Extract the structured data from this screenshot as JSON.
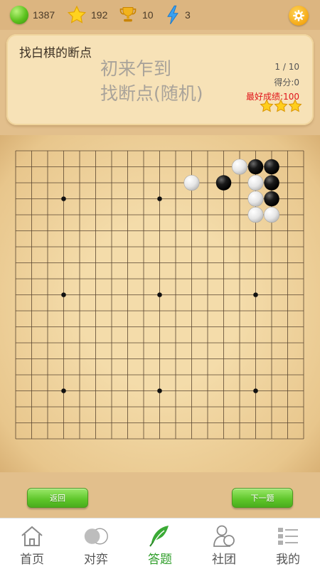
{
  "stats": {
    "gems": "1387",
    "stars": "192",
    "trophies": "10",
    "energy": "3"
  },
  "card": {
    "title": "找白棋的断点",
    "subtitle_line1": "初来乍到",
    "subtitle_line2": "找断点(随机)",
    "progress": "1 / 10",
    "score": "得分:0",
    "best": "最好成绩:100",
    "stars_earned": 3
  },
  "board": {
    "size": 19,
    "hoshi": [
      [
        3,
        3
      ],
      [
        3,
        9
      ],
      [
        3,
        15
      ],
      [
        9,
        3
      ],
      [
        9,
        9
      ],
      [
        9,
        15
      ],
      [
        15,
        3
      ],
      [
        15,
        9
      ],
      [
        15,
        15
      ]
    ],
    "stones": [
      {
        "color": "white",
        "row": 1,
        "col": 14
      },
      {
        "color": "black",
        "row": 1,
        "col": 15
      },
      {
        "color": "black",
        "row": 1,
        "col": 16
      },
      {
        "color": "white",
        "row": 2,
        "col": 11
      },
      {
        "color": "black",
        "row": 2,
        "col": 13
      },
      {
        "color": "white",
        "row": 2,
        "col": 15
      },
      {
        "color": "black",
        "row": 2,
        "col": 16
      },
      {
        "color": "white",
        "row": 3,
        "col": 15
      },
      {
        "color": "black",
        "row": 3,
        "col": 16
      },
      {
        "color": "white",
        "row": 4,
        "col": 15
      },
      {
        "color": "white",
        "row": 4,
        "col": 16
      }
    ]
  },
  "nav": {
    "back_label": "返回",
    "next_label": "下一题"
  },
  "tabs": [
    {
      "label": "首页",
      "icon": "home-icon",
      "active": false
    },
    {
      "label": "对弈",
      "icon": "stones-icon",
      "active": false
    },
    {
      "label": "答题",
      "icon": "feather-icon",
      "active": true
    },
    {
      "label": "社团",
      "icon": "club-icon",
      "active": false
    },
    {
      "label": "我的",
      "icon": "menu-list-icon",
      "active": false
    }
  ],
  "colors": {
    "accent_green": "#2f9e2a",
    "best_red": "#e0141a",
    "board_line": "#5a4630"
  }
}
